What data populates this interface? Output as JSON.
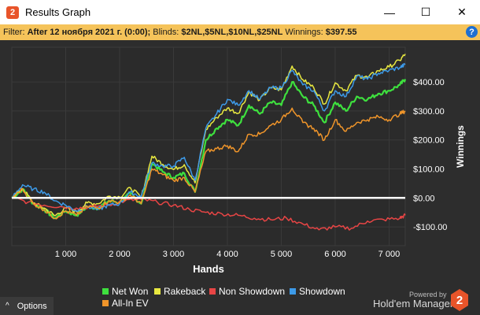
{
  "window": {
    "title": "Results Graph",
    "app_icon_glyph": "2",
    "minimize": "—",
    "maximize": "☐",
    "close": "✕"
  },
  "filter": {
    "label": "Filter:",
    "date": "After 12 ноября 2021 г. (0:00);",
    "blinds_label": "Blinds:",
    "blinds": "$2NL,$5NL,$10NL,$25NL",
    "winnings_label": "Winnings:",
    "winnings": "$397.55",
    "help": "?"
  },
  "footer": {
    "options_label": "Options",
    "options_icon": "^",
    "powered_by": "Powered by",
    "brand": "Hold'em Manager",
    "brand_logo": "2"
  },
  "chart_data": {
    "type": "line",
    "xlabel": "Hands",
    "ylabel": "Winnings",
    "xlim": [
      0,
      7300
    ],
    "ylim": [
      -165,
      520
    ],
    "xticks": [
      1000,
      2000,
      3000,
      4000,
      5000,
      6000,
      7000
    ],
    "xtick_labels": [
      "1 000",
      "2 000",
      "3 000",
      "4 000",
      "5 000",
      "6 000",
      "7 000"
    ],
    "yticks": [
      400,
      300,
      200,
      100,
      0,
      -100
    ],
    "ytick_labels": [
      "$400.00",
      "$300.00",
      "$200.00",
      "$100.00",
      "$0.00",
      "-$100.00"
    ],
    "y_axis_position": "right",
    "legend_position": "bottom",
    "grid": true,
    "series": [
      {
        "name": "Net Won",
        "color": "#3ee03e",
        "x": [
          0,
          200,
          400,
          600,
          800,
          1000,
          1200,
          1400,
          1600,
          1800,
          2000,
          2200,
          2400,
          2600,
          2800,
          3000,
          3200,
          3400,
          3600,
          3800,
          4000,
          4200,
          4400,
          4600,
          4800,
          5000,
          5200,
          5400,
          5600,
          5800,
          6000,
          6200,
          6400,
          6600,
          6800,
          7000,
          7200,
          7300
        ],
        "y": [
          0,
          30,
          -20,
          -40,
          -70,
          -45,
          -60,
          -30,
          -35,
          -10,
          -15,
          15,
          -20,
          120,
          90,
          70,
          85,
          20,
          200,
          240,
          270,
          250,
          320,
          290,
          330,
          320,
          400,
          350,
          320,
          260,
          330,
          300,
          350,
          340,
          360,
          370,
          390,
          410
        ]
      },
      {
        "name": "Rakeback",
        "color": "#e8e840",
        "x": [
          0,
          200,
          400,
          600,
          800,
          1000,
          1200,
          1400,
          1600,
          1800,
          2000,
          2200,
          2400,
          2600,
          2800,
          3000,
          3200,
          3400,
          3600,
          3800,
          4000,
          4200,
          4400,
          4600,
          4800,
          5000,
          5200,
          5400,
          5600,
          5800,
          6000,
          6200,
          6400,
          6600,
          6800,
          7000,
          7200,
          7300
        ],
        "y": [
          0,
          32,
          -17,
          -35,
          -62,
          -35,
          -48,
          -17,
          -20,
          6,
          3,
          35,
          2,
          144,
          116,
          98,
          115,
          52,
          235,
          277,
          310,
          292,
          365,
          338,
          380,
          373,
          455,
          408,
          381,
          324,
          397,
          370,
          423,
          416,
          439,
          452,
          475,
          497
        ]
      },
      {
        "name": "Non Showdown",
        "color": "#e84545",
        "x": [
          0,
          300,
          600,
          900,
          1200,
          1500,
          1800,
          2100,
          2400,
          2700,
          3000,
          3300,
          3600,
          3900,
          4200,
          4500,
          4800,
          5100,
          5400,
          5700,
          6000,
          6300,
          6600,
          6900,
          7200,
          7300
        ],
        "y": [
          0,
          -15,
          -25,
          -30,
          -35,
          -30,
          -25,
          -10,
          -5,
          -15,
          -25,
          -40,
          -50,
          -55,
          -60,
          -70,
          -75,
          -70,
          -90,
          -110,
          -100,
          -105,
          -80,
          -75,
          -70,
          -60
        ]
      },
      {
        "name": "Showdown",
        "color": "#3d9ae8",
        "x": [
          0,
          200,
          400,
          600,
          800,
          1000,
          1200,
          1400,
          1600,
          1800,
          2000,
          2200,
          2400,
          2600,
          2800,
          3000,
          3200,
          3400,
          3600,
          3800,
          4000,
          4200,
          4400,
          4600,
          4800,
          5000,
          5200,
          5400,
          5600,
          5800,
          6000,
          6200,
          6400,
          6600,
          6800,
          7000,
          7200,
          7300
        ],
        "y": [
          0,
          45,
          30,
          20,
          -10,
          -25,
          -45,
          -30,
          -40,
          -25,
          -20,
          20,
          5,
          120,
          110,
          110,
          140,
          60,
          240,
          290,
          340,
          320,
          370,
          340,
          380,
          380,
          440,
          390,
          370,
          300,
          370,
          350,
          420,
          410,
          430,
          440,
          450,
          460
        ]
      },
      {
        "name": "All-In EV",
        "color": "#f0952a",
        "x": [
          0,
          200,
          400,
          600,
          800,
          1000,
          1200,
          1400,
          1600,
          1800,
          2000,
          2200,
          2400,
          2600,
          2800,
          3000,
          3200,
          3400,
          3600,
          3800,
          4000,
          4200,
          4400,
          4600,
          4800,
          5000,
          5200,
          5400,
          5600,
          5800,
          6000,
          6200,
          6400,
          6600,
          6800,
          7000,
          7200,
          7300
        ],
        "y": [
          0,
          30,
          -20,
          -40,
          -70,
          -45,
          -60,
          -30,
          -35,
          -10,
          -15,
          10,
          -20,
          100,
          80,
          60,
          70,
          20,
          160,
          170,
          180,
          160,
          220,
          220,
          250,
          270,
          310,
          260,
          240,
          200,
          270,
          230,
          260,
          270,
          280,
          270,
          290,
          300
        ]
      }
    ],
    "zero_line_color": "#ffffff"
  }
}
